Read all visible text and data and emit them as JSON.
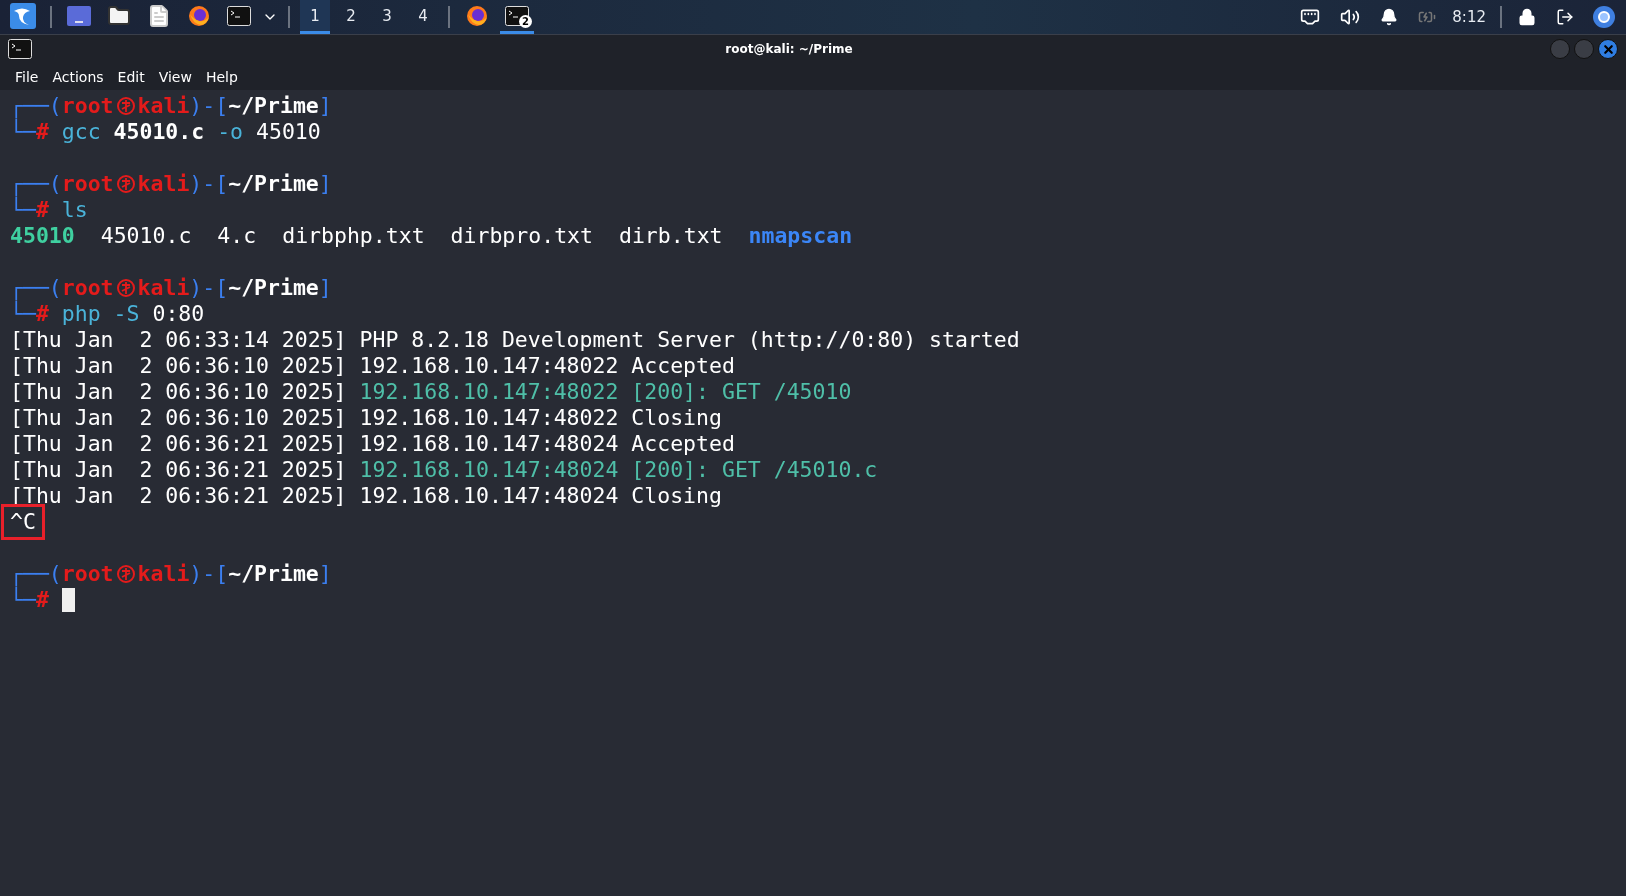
{
  "taskbar": {
    "workspaces": [
      {
        "label": "1",
        "selected": true
      },
      {
        "label": "2",
        "selected": false
      },
      {
        "label": "3",
        "selected": false
      },
      {
        "label": "4",
        "selected": false
      }
    ],
    "terminal_badge": "2",
    "clock": "8:12"
  },
  "window": {
    "title": "root@kali: ~/Prime",
    "menu": [
      "File",
      "Actions",
      "Edit",
      "View",
      "Help"
    ]
  },
  "terminal": [
    {
      "kind": "prompt",
      "open": "┌──(",
      "user": "root",
      "host": "kali",
      "mid": ")-[",
      "path": "~/Prime",
      "close": "]",
      "corner": "└─",
      "symbol": "#",
      "command": [
        {
          "text": "gcc",
          "kind": "command"
        },
        {
          "text": "45010.c",
          "kind": "file"
        },
        {
          "text": "-o",
          "kind": "option"
        },
        {
          "text": "45010",
          "kind": "argument"
        }
      ]
    },
    {
      "kind": "blank"
    },
    {
      "kind": "prompt",
      "open": "┌──(",
      "user": "root",
      "host": "kali",
      "mid": ")-[",
      "path": "~/Prime",
      "close": "]",
      "corner": "└─",
      "symbol": "#",
      "command": [
        {
          "text": "ls",
          "kind": "command"
        }
      ]
    },
    {
      "kind": "listing",
      "items": [
        {
          "text": "45010",
          "kind": "executable"
        },
        {
          "text": "45010.c",
          "kind": "file"
        },
        {
          "text": "4.c",
          "kind": "file"
        },
        {
          "text": "dirbphp.txt",
          "kind": "file"
        },
        {
          "text": "dirbpro.txt",
          "kind": "file"
        },
        {
          "text": "dirb.txt",
          "kind": "file"
        },
        {
          "text": "nmapscan",
          "kind": "directory"
        }
      ]
    },
    {
      "kind": "blank"
    },
    {
      "kind": "prompt",
      "open": "┌──(",
      "user": "root",
      "host": "kali",
      "mid": ")-[",
      "path": "~/Prime",
      "close": "]",
      "corner": "└─",
      "symbol": "#",
      "command": [
        {
          "text": "php",
          "kind": "command"
        },
        {
          "text": "-S",
          "kind": "option"
        },
        {
          "text": "0:80",
          "kind": "argument"
        }
      ]
    },
    {
      "kind": "output",
      "head": "[Thu Jan  2 06:33:14 2025] ",
      "text": "PHP 8.2.18 Development Server (http://0:80) started",
      "request": false
    },
    {
      "kind": "output",
      "head": "[Thu Jan  2 06:36:10 2025] ",
      "text": "192.168.10.147:48022 Accepted",
      "request": false
    },
    {
      "kind": "output",
      "head": "[Thu Jan  2 06:36:10 2025] ",
      "text": "192.168.10.147:48022 [200]: GET /45010",
      "request": true
    },
    {
      "kind": "output",
      "head": "[Thu Jan  2 06:36:10 2025] ",
      "text": "192.168.10.147:48022 Closing",
      "request": false
    },
    {
      "kind": "output",
      "head": "[Thu Jan  2 06:36:21 2025] ",
      "text": "192.168.10.147:48024 Accepted",
      "request": false
    },
    {
      "kind": "output",
      "head": "[Thu Jan  2 06:36:21 2025] ",
      "text": "192.168.10.147:48024 [200]: GET /45010.c",
      "request": true
    },
    {
      "kind": "output",
      "head": "[Thu Jan  2 06:36:21 2025] ",
      "text": "192.168.10.147:48024 Closing",
      "request": false
    },
    {
      "kind": "interrupt",
      "text": "^C",
      "highlighted": true
    },
    {
      "kind": "blank"
    },
    {
      "kind": "prompt",
      "open": "┌──(",
      "user": "root",
      "host": "kali",
      "mid": ")-[",
      "path": "~/Prime",
      "close": "]",
      "corner": "└─",
      "symbol": "#",
      "cursor": true
    }
  ]
}
